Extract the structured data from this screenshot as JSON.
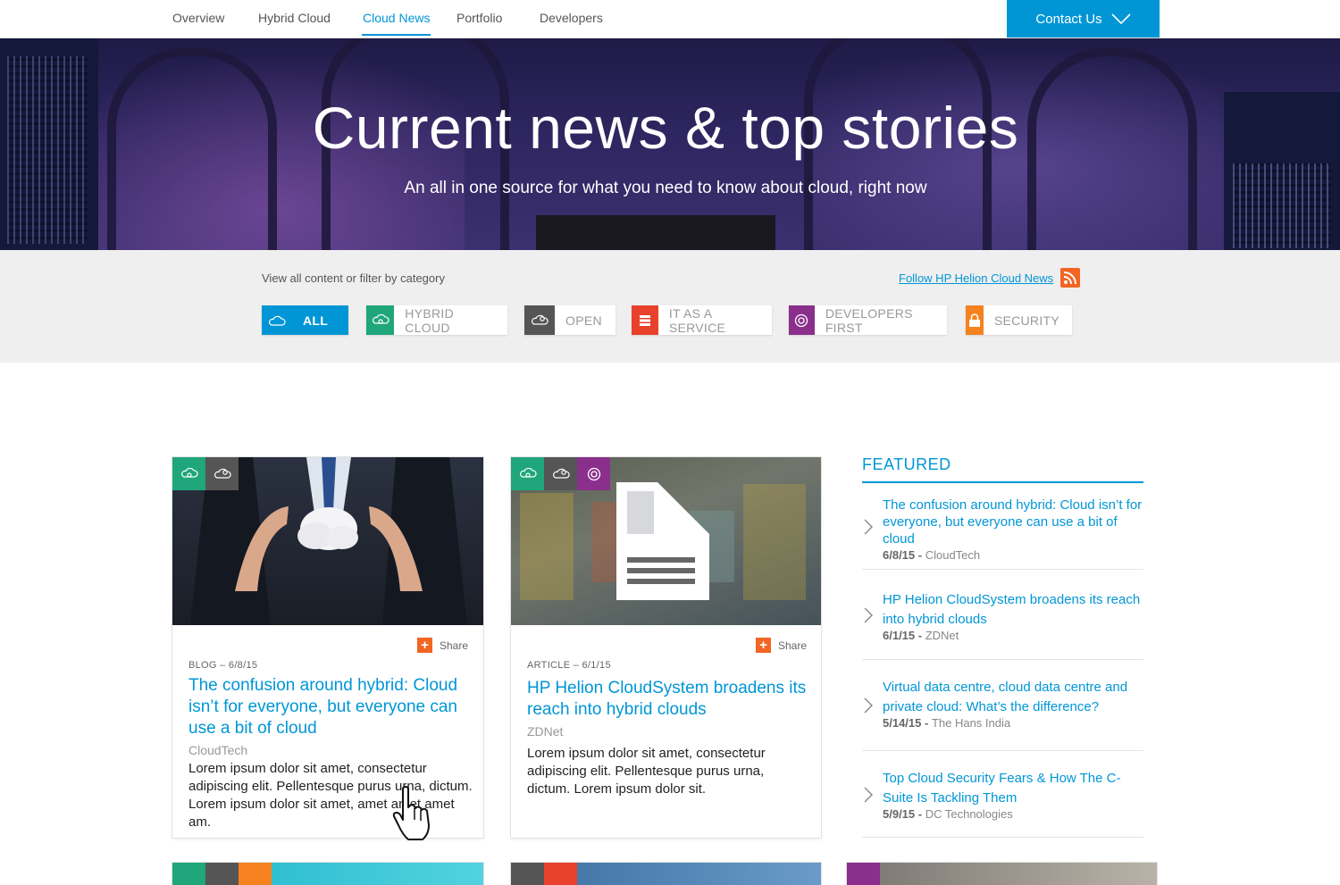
{
  "nav": {
    "items": [
      {
        "label": "Overview",
        "active": false
      },
      {
        "label": "Hybrid Cloud",
        "active": false
      },
      {
        "label": "Cloud News",
        "active": true
      },
      {
        "label": "Portfolio",
        "active": false
      },
      {
        "label": "Developers",
        "active": false
      }
    ],
    "contact_label": "Contact Us"
  },
  "hero": {
    "title": "Current news & top stories",
    "subtitle": "An all in one source for what you need to know about cloud, right now"
  },
  "filter": {
    "label": "View all content or filter by category",
    "follow_label": "Follow HP Helion Cloud News",
    "categories": [
      {
        "label": "ALL",
        "color": "#0096d6",
        "icon": "cloud-icon",
        "selected": true
      },
      {
        "label": "HYBRID CLOUD",
        "color": "#1fa67a",
        "icon": "hybrid-cloud-icon",
        "selected": false
      },
      {
        "label": "OPEN",
        "color": "#555555",
        "icon": "open-cloud-icon",
        "selected": false
      },
      {
        "label": "IT AS A SERVICE",
        "color": "#e8412c",
        "icon": "server-icon",
        "selected": false
      },
      {
        "label": "DEVELOPERS FIRST",
        "color": "#8a2f8c",
        "icon": "developer-icon",
        "selected": false
      },
      {
        "label": "SECURITY",
        "color": "#f5821f",
        "icon": "lock-icon",
        "selected": false
      }
    ]
  },
  "cards": [
    {
      "share": "Share",
      "meta": "BLOG – 6/8/15",
      "title": "The confusion around hybrid: Cloud isn’t for everyone, but everyone can use a bit of cloud",
      "source": "CloudTech",
      "body": "Lorem ipsum dolor sit amet, consectetur adipiscing elit. Pellentesque purus urna, dictum. Lorem ipsum dolor sit amet, amet amet amet am."
    },
    {
      "share": "Share",
      "meta": "ARTICLE – 6/1/15",
      "title": "HP Helion CloudSystem broadens its reach into hybrid clouds",
      "source": "ZDNet",
      "body": "Lorem ipsum dolor sit amet, consectetur adipiscing elit. Pellentesque purus urna, dictum. Lorem ipsum dolor sit."
    }
  ],
  "featured": {
    "heading": "FEATURED",
    "items": [
      {
        "title": "The confusion around hybrid: Cloud isn’t for everyone, but everyone can use a bit of cloud",
        "date": "6/8/15",
        "source": "CloudTech"
      },
      {
        "title": "HP Helion CloudSystem broadens its reach into hybrid clouds",
        "date": "6/1/15",
        "source": "ZDNet"
      },
      {
        "title": "Virtual data centre, cloud data centre and private cloud: What’s the difference?",
        "date": "5/14/15",
        "source": "The Hans India"
      },
      {
        "title": "Top Cloud Security Fears & How The C-Suite Is Tackling Them",
        "date": "5/9/15",
        "source": "DC Technologies"
      }
    ],
    "separator": " - "
  }
}
